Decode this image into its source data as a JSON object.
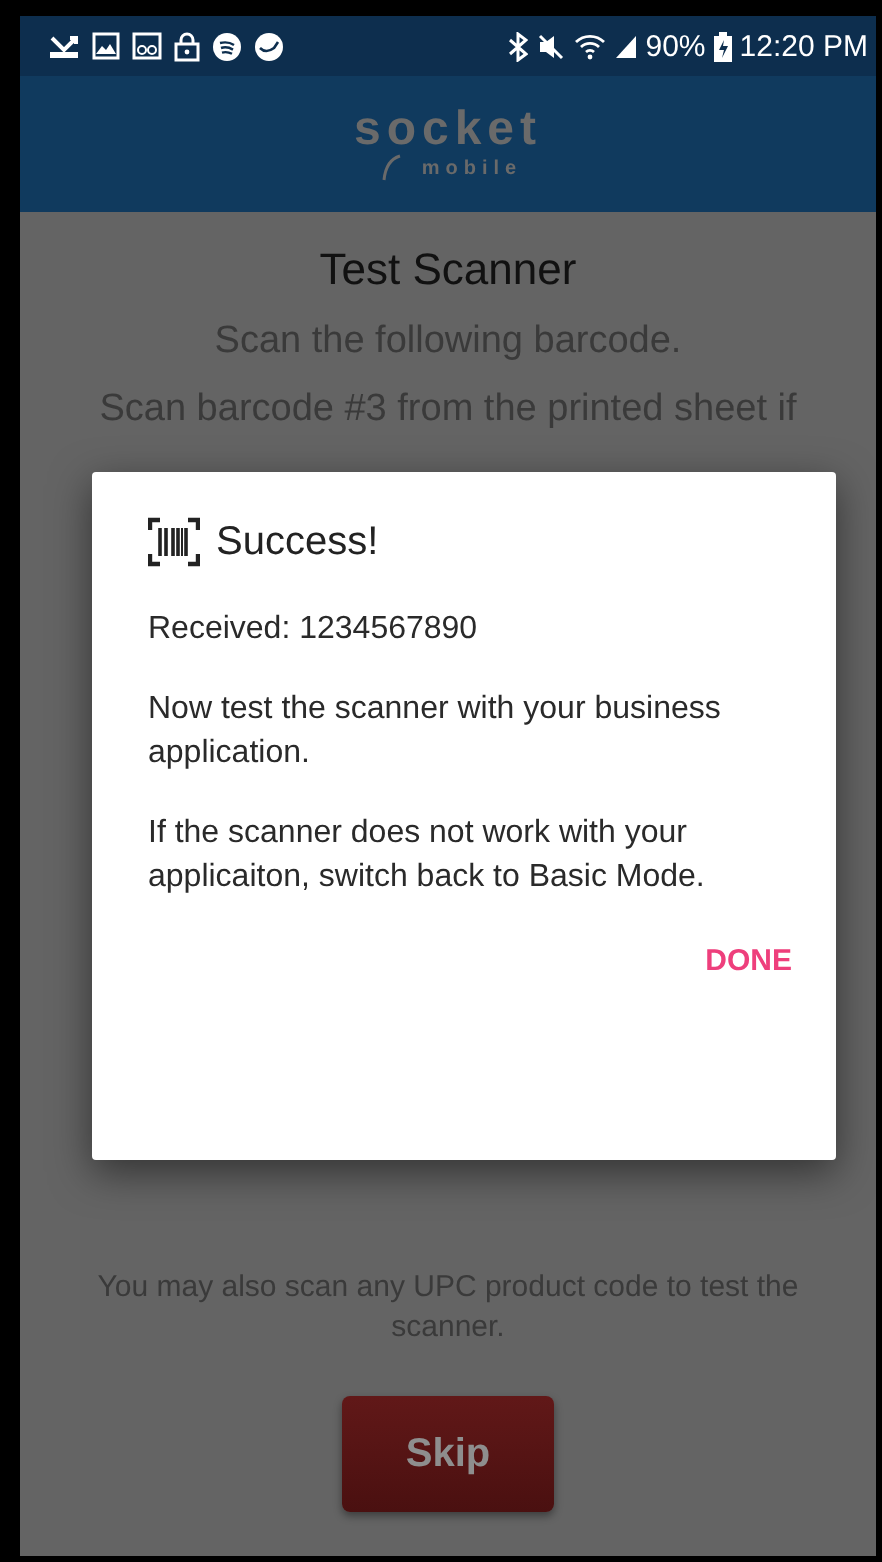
{
  "status_bar": {
    "battery": "90%",
    "time": "12:20 PM"
  },
  "app_bar": {
    "logo_word": "socket",
    "logo_subword": "mobile"
  },
  "screen": {
    "title": "Test Scanner",
    "instruction": "Scan the following barcode.",
    "instruction_2": "Scan barcode #3 from the printed sheet if",
    "note": "You may also scan any UPC product code to test the scanner.",
    "skip_button": "Skip"
  },
  "dialog": {
    "title": "Success!",
    "paragraphs": [
      "Received: 1234567890",
      "Now test the scanner with your business application.",
      "If the scanner does not work with your applicaiton, switch back to Basic Mode."
    ],
    "button": "DONE"
  }
}
